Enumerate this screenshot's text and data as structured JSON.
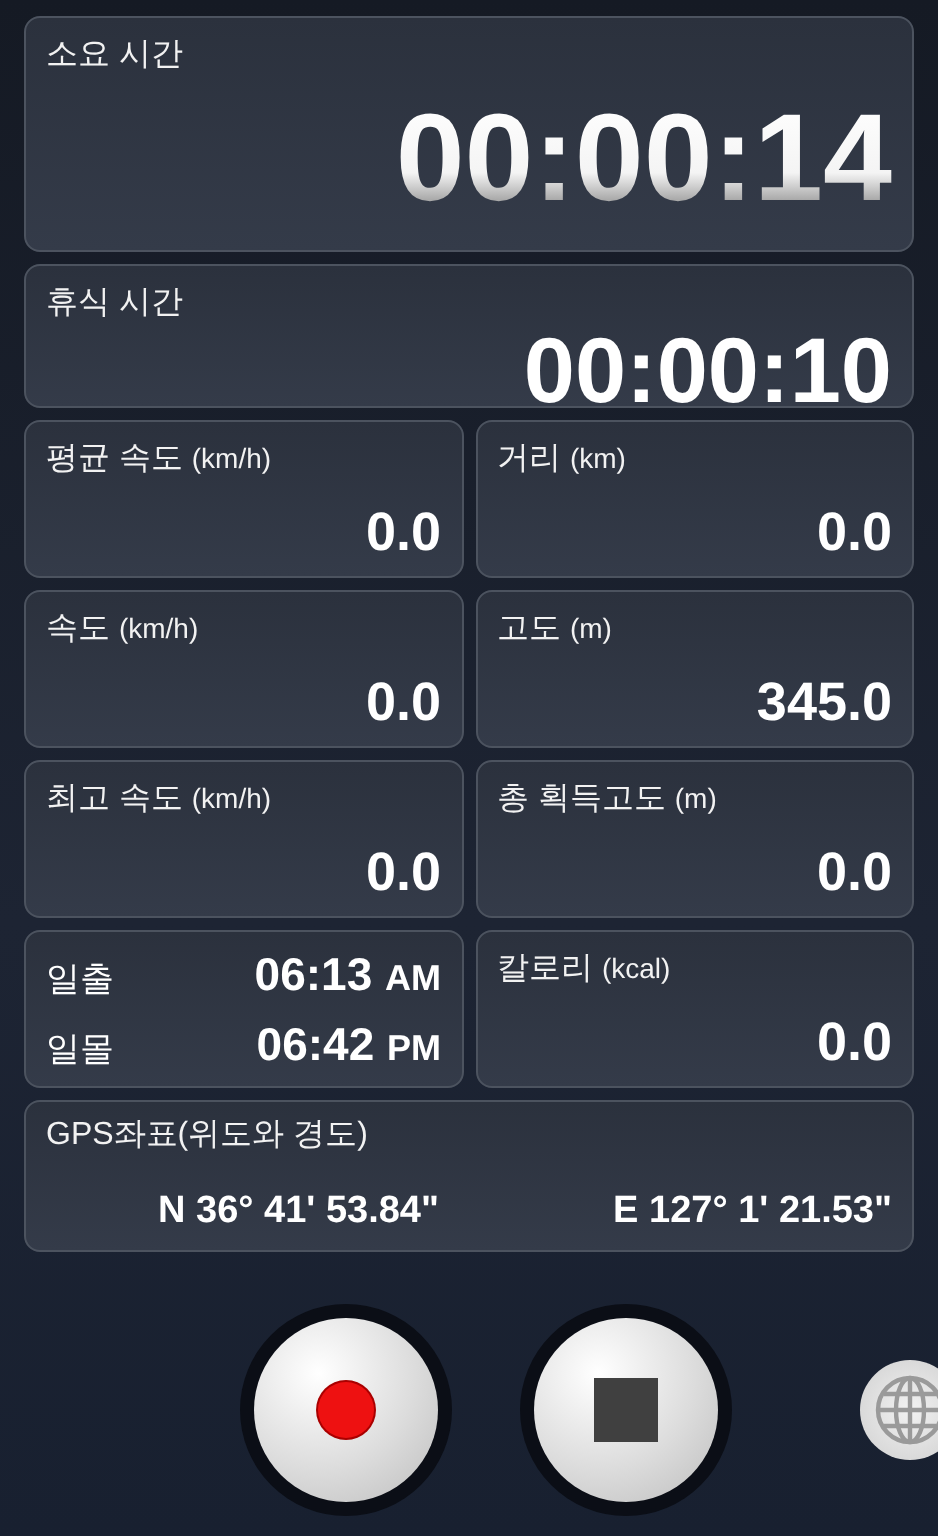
{
  "timers": [
    {
      "kind": "main",
      "label": "소요 시간",
      "value": "00:00:14"
    },
    {
      "kind": "rest",
      "label": "휴식 시간",
      "value": "00:00:10"
    }
  ],
  "cells": [
    {
      "kind": "metric",
      "label": "평균 속도",
      "unit": "(km/h)",
      "value": "0.0"
    },
    {
      "kind": "metric",
      "label": "거리",
      "unit": "(km)",
      "value": "0.0"
    },
    {
      "kind": "metric",
      "label": "속도",
      "unit": "(km/h)",
      "value": "0.0"
    },
    {
      "kind": "metric",
      "label": "고도",
      "unit": "(m)",
      "value": "345.0"
    },
    {
      "kind": "metric",
      "label": "최고 속도",
      "unit": "(km/h)",
      "value": "0.0"
    },
    {
      "kind": "metric",
      "label": "총 획득고도",
      "unit": "(m)",
      "value": "0.0"
    },
    {
      "kind": "sun",
      "rows": [
        {
          "label": "일출",
          "time": "06:13",
          "period": "AM"
        },
        {
          "label": "일몰",
          "time": "06:42",
          "period": "PM"
        }
      ]
    },
    {
      "kind": "metric",
      "label": "칼로리",
      "unit": "(kcal)",
      "value": "0.0"
    }
  ],
  "gps": {
    "label": "GPS좌표(위도와 경도)",
    "latitude": "N 36° 41' 53.84\"",
    "longitude": "E 127° 1' 21.53\""
  },
  "controls": [
    {
      "kind": "record"
    },
    {
      "kind": "stop"
    },
    {
      "kind": "globe"
    }
  ]
}
